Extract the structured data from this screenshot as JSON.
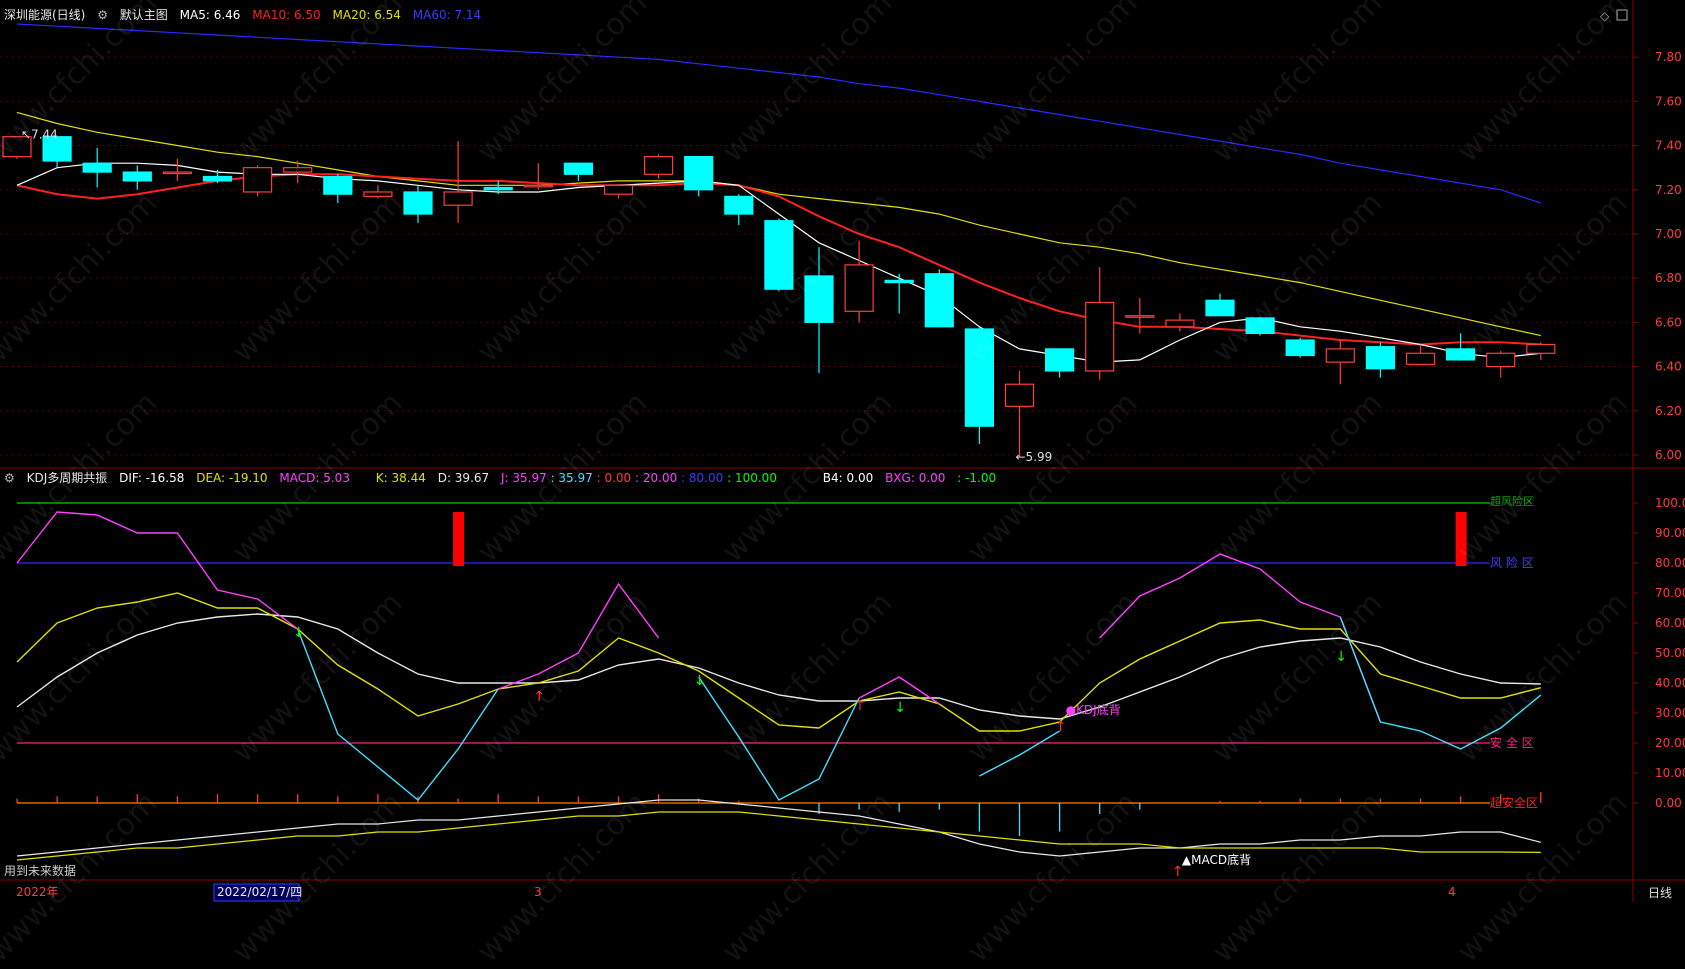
{
  "main_header": {
    "title": "深圳能源(日线)",
    "gear_icon": "gear-icon",
    "template": "默认主图",
    "ma5": "MA5: 6.46",
    "ma10": "MA10: 6.50",
    "ma20": "MA20: 6.54",
    "ma60": "MA60: 7.14"
  },
  "sub_header": {
    "title": "KDJ多周期共振",
    "dif": "DIF: -16.58",
    "dea": "DEA: -19.10",
    "macd": "MACD: 5.03",
    "k": "K: 38.44",
    "d": "D: 39.67",
    "j": "J: 35.97",
    "j2": ": 35.97",
    "l0": ": 0.00",
    "l20": ": 20.00",
    "l80": ": 80.00",
    "l100": ": 100.00",
    "b4": "B4: 0.00",
    "bxg": "BXG: 0.00",
    "neg1": ": -1.00"
  },
  "labels": {
    "high_mark": "7.44",
    "low_mark": "5.99",
    "kdj_div": "KDJ底背",
    "macd_div": "MACD底背",
    "zone_risk": "风 险 区",
    "zone_safe": "安 全 区",
    "zone_super_safe": "超安全区",
    "zone_top": "超风险区",
    "footer_left": "用到未来数据",
    "footer_right": "日线",
    "x_2022": "2022年",
    "x_date": "2022/02/17/四",
    "x_3": "3",
    "x_4": "4",
    "watermark": "www.cfchi.com"
  },
  "colors": {
    "up": "#ff3b3b",
    "down": "#00ffff",
    "ma5": "#ffffff",
    "ma10": "#ff2020",
    "ma20": "#e0e000",
    "ma60": "#2a2aff",
    "k": "#e0e000",
    "d": "#e8e8e8",
    "j": "#ff40ff",
    "j2": "#40e0ff"
  },
  "chart_data": [
    {
      "type": "candlestick",
      "ylim": [
        5.95,
        7.95
      ],
      "yticks": [
        "6.00",
        "6.20",
        "6.40",
        "6.60",
        "6.80",
        "7.00",
        "7.20",
        "7.40",
        "7.60",
        "7.80"
      ],
      "candles": [
        {
          "o": 7.35,
          "c": 7.44,
          "h": 7.44,
          "l": 7.34
        },
        {
          "o": 7.44,
          "c": 7.33,
          "h": 7.44,
          "l": 7.3
        },
        {
          "o": 7.32,
          "c": 7.28,
          "h": 7.39,
          "l": 7.21
        },
        {
          "o": 7.28,
          "c": 7.24,
          "h": 7.31,
          "l": 7.2
        },
        {
          "o": 7.28,
          "c": 7.28,
          "h": 7.34,
          "l": 7.24
        },
        {
          "o": 7.26,
          "c": 7.24,
          "h": 7.29,
          "l": 7.23
        },
        {
          "o": 7.19,
          "c": 7.3,
          "h": 7.31,
          "l": 7.17
        },
        {
          "o": 7.28,
          "c": 7.3,
          "h": 7.33,
          "l": 7.23
        },
        {
          "o": 7.26,
          "c": 7.18,
          "h": 7.27,
          "l": 7.14
        },
        {
          "o": 7.17,
          "c": 7.19,
          "h": 7.22,
          "l": 7.16
        },
        {
          "o": 7.19,
          "c": 7.09,
          "h": 7.22,
          "l": 7.05
        },
        {
          "o": 7.13,
          "c": 7.19,
          "h": 7.42,
          "l": 7.05
        },
        {
          "o": 7.21,
          "c": 7.2,
          "h": 7.24,
          "l": 7.18
        },
        {
          "o": 7.22,
          "c": 7.22,
          "h": 7.32,
          "l": 7.2
        },
        {
          "o": 7.32,
          "c": 7.27,
          "h": 7.32,
          "l": 7.24
        },
        {
          "o": 7.18,
          "c": 7.22,
          "h": 7.22,
          "l": 7.16
        },
        {
          "o": 7.27,
          "c": 7.35,
          "h": 7.36,
          "l": 7.25
        },
        {
          "o": 7.35,
          "c": 7.2,
          "h": 7.35,
          "l": 7.17
        },
        {
          "o": 7.17,
          "c": 7.09,
          "h": 7.18,
          "l": 7.04
        },
        {
          "o": 7.06,
          "c": 6.75,
          "h": 7.07,
          "l": 6.74
        },
        {
          "o": 6.81,
          "c": 6.6,
          "h": 6.94,
          "l": 6.37
        },
        {
          "o": 6.65,
          "c": 6.86,
          "h": 6.97,
          "l": 6.6
        },
        {
          "o": 6.79,
          "c": 6.78,
          "h": 6.82,
          "l": 6.64
        },
        {
          "o": 6.82,
          "c": 6.58,
          "h": 6.84,
          "l": 6.58
        },
        {
          "o": 6.57,
          "c": 6.13,
          "h": 6.58,
          "l": 6.05
        },
        {
          "o": 6.22,
          "c": 6.32,
          "h": 6.38,
          "l": 5.99
        },
        {
          "o": 6.48,
          "c": 6.38,
          "h": 6.48,
          "l": 6.35
        },
        {
          "o": 6.38,
          "c": 6.69,
          "h": 6.85,
          "l": 6.34
        },
        {
          "o": 6.63,
          "c": 6.63,
          "h": 6.71,
          "l": 6.55
        },
        {
          "o": 6.58,
          "c": 6.61,
          "h": 6.64,
          "l": 6.56
        },
        {
          "o": 6.7,
          "c": 6.63,
          "h": 6.73,
          "l": 6.63
        },
        {
          "o": 6.62,
          "c": 6.55,
          "h": 6.62,
          "l": 6.54
        },
        {
          "o": 6.52,
          "c": 6.45,
          "h": 6.53,
          "l": 6.44
        },
        {
          "o": 6.42,
          "c": 6.48,
          "h": 6.52,
          "l": 6.32
        },
        {
          "o": 6.49,
          "c": 6.39,
          "h": 6.51,
          "l": 6.35
        },
        {
          "o": 6.41,
          "c": 6.46,
          "h": 6.5,
          "l": 6.41
        },
        {
          "o": 6.48,
          "c": 6.43,
          "h": 6.55,
          "l": 6.43
        },
        {
          "o": 6.4,
          "c": 6.46,
          "h": 6.47,
          "l": 6.35
        },
        {
          "o": 6.46,
          "c": 6.5,
          "h": 6.51,
          "l": 6.43
        }
      ],
      "ma5": [
        7.22,
        7.3,
        7.32,
        7.32,
        7.31,
        7.28,
        7.27,
        7.27,
        7.25,
        7.24,
        7.22,
        7.2,
        7.19,
        7.19,
        7.21,
        7.22,
        7.23,
        7.24,
        7.22,
        7.09,
        6.96,
        6.88,
        6.8,
        6.72,
        6.58,
        6.48,
        6.45,
        6.42,
        6.43,
        6.52,
        6.6,
        6.62,
        6.58,
        6.56,
        6.53,
        6.5,
        6.46,
        6.44,
        6.46
      ],
      "ma10": [
        7.22,
        7.18,
        7.16,
        7.18,
        7.21,
        7.24,
        7.26,
        7.27,
        7.27,
        7.26,
        7.25,
        7.24,
        7.24,
        7.23,
        7.22,
        7.22,
        7.22,
        7.23,
        7.22,
        7.17,
        7.08,
        7.0,
        6.94,
        6.86,
        6.78,
        6.71,
        6.65,
        6.61,
        6.58,
        6.58,
        6.57,
        6.56,
        6.54,
        6.52,
        6.51,
        6.5,
        6.51,
        6.51,
        6.5
      ],
      "ma20": [
        7.55,
        7.5,
        7.46,
        7.43,
        7.4,
        7.37,
        7.35,
        7.32,
        7.29,
        7.26,
        7.24,
        7.22,
        7.22,
        7.22,
        7.23,
        7.24,
        7.24,
        7.24,
        7.22,
        7.18,
        7.16,
        7.14,
        7.12,
        7.09,
        7.04,
        7.0,
        6.96,
        6.94,
        6.91,
        6.87,
        6.84,
        6.81,
        6.78,
        6.74,
        6.7,
        6.66,
        6.62,
        6.58,
        6.54
      ],
      "ma60": [
        7.95,
        7.94,
        7.93,
        7.92,
        7.91,
        7.9,
        7.89,
        7.88,
        7.87,
        7.86,
        7.85,
        7.84,
        7.83,
        7.82,
        7.81,
        7.8,
        7.79,
        7.77,
        7.75,
        7.73,
        7.71,
        7.68,
        7.66,
        7.63,
        7.6,
        7.57,
        7.54,
        7.51,
        7.48,
        7.45,
        7.42,
        7.39,
        7.36,
        7.32,
        7.29,
        7.26,
        7.23,
        7.2,
        7.14
      ],
      "annotations": [
        {
          "text": "7.44",
          "index": 0
        },
        {
          "text": "5.99",
          "index": 25
        }
      ]
    },
    {
      "type": "line",
      "ylim": [
        -25,
        105
      ],
      "yticks": [
        "0.00",
        "10.00",
        "20.00",
        "30.00",
        "40.00",
        "50.00",
        "60.00",
        "70.00",
        "80.00",
        "90.00",
        "100.00"
      ],
      "levels": [
        0,
        20,
        80,
        100
      ],
      "series": [
        {
          "name": "K",
          "values": [
            47,
            60,
            65,
            67,
            70,
            65,
            65,
            58,
            46,
            38,
            29,
            33,
            38,
            40,
            44,
            55,
            50,
            44,
            35,
            26,
            25,
            34,
            37,
            33,
            24,
            24,
            27,
            40,
            48,
            54,
            60,
            61,
            58,
            58,
            43,
            39,
            35,
            35,
            38.44
          ]
        },
        {
          "name": "D",
          "values": [
            32,
            42,
            50,
            56,
            60,
            62,
            63,
            62,
            58,
            50,
            43,
            40,
            40,
            40,
            41,
            46,
            48,
            45,
            40,
            36,
            34,
            34,
            35,
            35,
            31,
            29,
            28,
            32,
            37,
            42,
            48,
            52,
            54,
            55,
            52,
            47,
            43,
            40,
            39.67
          ]
        },
        {
          "name": "J",
          "values": [
            80,
            97,
            96,
            90,
            90,
            71,
            68,
            58,
            null,
            null,
            null,
            null,
            38,
            43,
            50,
            73,
            55,
            null,
            null,
            null,
            null,
            35,
            42,
            33,
            null,
            null,
            null,
            55,
            69,
            75,
            83,
            78,
            67,
            62,
            27,
            null,
            null,
            null,
            null
          ]
        },
        {
          "name": "J",
          "values": [
            null,
            null,
            null,
            null,
            null,
            null,
            null,
            58,
            23,
            12,
            1,
            18,
            38,
            null,
            null,
            null,
            null,
            42,
            22,
            1,
            8,
            35,
            null,
            null,
            9,
            16,
            24,
            null,
            null,
            null,
            null,
            null,
            null,
            62,
            27,
            24,
            18,
            25,
            35.97
          ]
        }
      ],
      "macd_hist": [
        2,
        3,
        3,
        4,
        3,
        4,
        4,
        4,
        3,
        4,
        3,
        2,
        4,
        3,
        3,
        3,
        4,
        2,
        1,
        0,
        -5,
        -3,
        -4,
        -3,
        -13,
        -15,
        -13,
        -5,
        -3,
        0,
        1,
        1,
        2,
        2,
        2,
        2,
        3,
        4,
        5.03
      ],
      "dif": [
        -20,
        -19,
        -18,
        -17,
        -16,
        -15,
        -14,
        -13,
        -12,
        -12,
        -11,
        -11,
        -10,
        -9,
        -8,
        -7,
        -6,
        -6,
        -7,
        -8,
        -9,
        -10,
        -12,
        -14,
        -17,
        -19,
        -20,
        -19,
        -18,
        -18,
        -17,
        -17,
        -16,
        -16,
        -15,
        -15,
        -14,
        -14,
        -16.58
      ],
      "dea": [
        -21,
        -20,
        -19,
        -18,
        -18,
        -17,
        -16,
        -15,
        -15,
        -14,
        -14,
        -13,
        -12,
        -11,
        -10,
        -10,
        -9,
        -9,
        -9,
        -10,
        -11,
        -12,
        -13,
        -14,
        -15,
        -16,
        -17,
        -17,
        -17,
        -18,
        -18,
        -18,
        -18,
        -18,
        -18,
        -19,
        -19,
        -19,
        -19.1
      ]
    }
  ]
}
